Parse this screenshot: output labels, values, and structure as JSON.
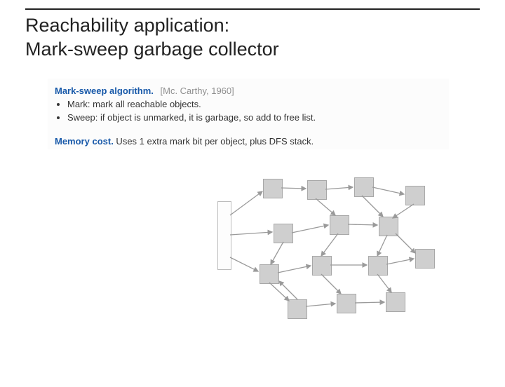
{
  "title": {
    "line1": "Reachability application:",
    "line2": "Mark-sweep garbage collector"
  },
  "algo": {
    "label": "Mark-sweep algorithm.",
    "cite": "[Mc. Carthy, 1960]",
    "markPrefix": "Mark:",
    "markText": " mark all reachable objects.",
    "sweepPrefix": "Sweep:",
    "sweepText": " if object is unmarked, it is garbage, so add to free list."
  },
  "mem": {
    "label": "Memory cost.",
    "text": " Uses 1 extra mark bit per object, plus DFS stack."
  }
}
